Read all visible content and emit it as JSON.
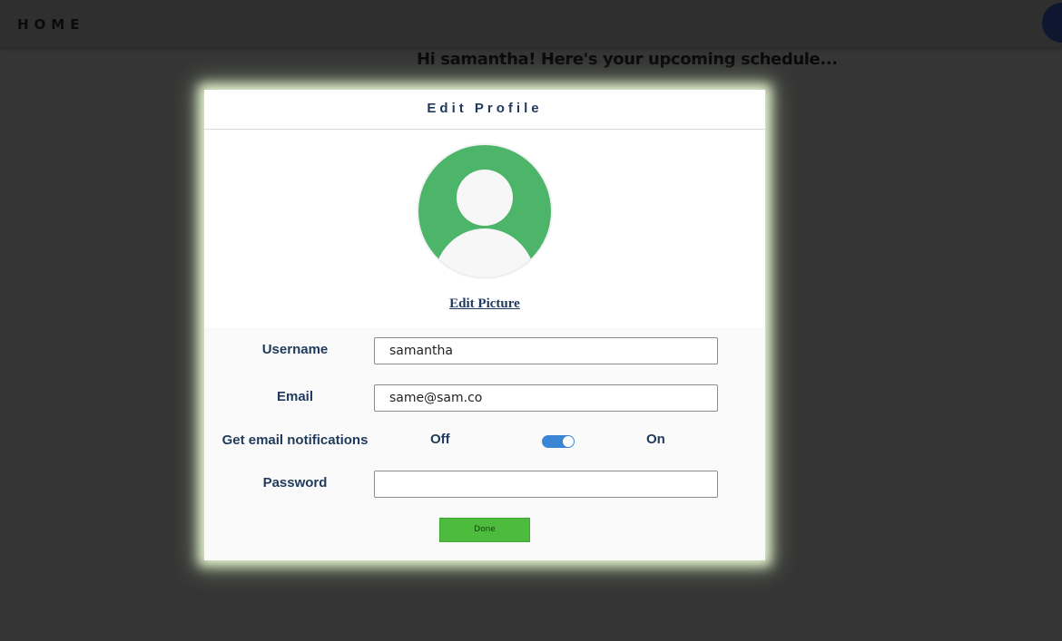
{
  "nav": {
    "home_label": "HOME"
  },
  "greeting": "Hi samantha! Here's your upcoming schedule...",
  "modal": {
    "title": "Edit Profile",
    "edit_picture_label": "Edit Picture",
    "fields": {
      "username": {
        "label": "Username",
        "value": "samantha"
      },
      "email": {
        "label": "Email",
        "value": "same@sam.co"
      },
      "notifications": {
        "label": "Get email notifications",
        "off_label": "Off",
        "on_label": "On",
        "enabled": true
      },
      "password": {
        "label": "Password",
        "value": ""
      }
    },
    "done_label": "Done"
  },
  "colors": {
    "accent_green": "#4cbb3e",
    "avatar_green": "#4db56a",
    "label_navy": "#1f3a5c",
    "toggle_blue": "#3a86d4"
  },
  "icons": {
    "profile_picture": "user-silhouette-icon"
  }
}
